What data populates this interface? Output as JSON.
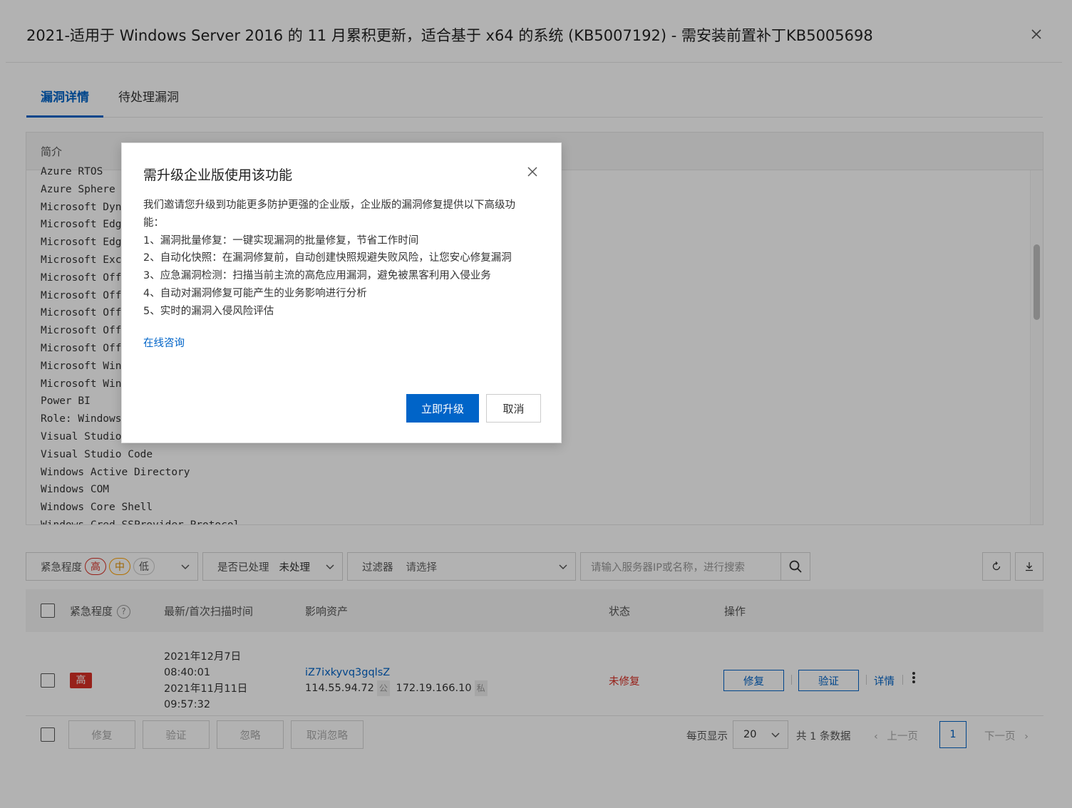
{
  "drawer": {
    "title": "2021-适用于 Windows Server 2016 的 11 月累积更新，适合基于 x64 的系统 (KB5007192) - 需安装前置补丁KB5005698"
  },
  "tabs": [
    {
      "label": "漏洞详情",
      "active": true
    },
    {
      "label": "待处理漏洞",
      "active": false
    }
  ],
  "intro": {
    "header": "简介",
    "items": [
      "Azure RTOS",
      "Azure Sphere",
      "Microsoft Dynamics",
      "Microsoft Edge (Chromium-based)",
      "Microsoft Edge (Chromium-based) in IE Mode",
      "Microsoft Exchange Server",
      "Microsoft Office",
      "Microsoft Office Access",
      "Microsoft Office Excel",
      "Microsoft Office SharePoint",
      "Microsoft Office Word",
      "Microsoft Windows",
      "Microsoft Windows Codecs Library",
      "Power BI",
      "Role: Windows Hyper-V",
      "Visual Studio",
      "Visual Studio Code",
      "Windows Active Directory",
      "Windows COM",
      "Windows Core Shell",
      "Windows Cred SSProvider Protocol"
    ]
  },
  "filters": {
    "severity_label": "紧急程度",
    "severity_high": "高",
    "severity_mid": "中",
    "severity_low": "低",
    "handled_label": "是否已处理",
    "handled_value": "未处理",
    "filter_label": "过滤器",
    "filter_placeholder": "请选择",
    "search_placeholder": "请输入服务器IP或名称，进行搜索"
  },
  "table": {
    "headers": {
      "severity": "紧急程度",
      "help": "?",
      "scan_time": "最新/首次扫描时间",
      "asset": "影响资产",
      "status": "状态",
      "actions": "操作"
    },
    "rows": [
      {
        "severity": "高",
        "latest_date": "2021年12月7日",
        "latest_time": "08:40:01",
        "first_date": "2021年11月11日",
        "first_time": "09:57:32",
        "asset_name": "iZ7ixkyvq3gqlsZ",
        "public_ip": "114.55.94.72",
        "public_tag": "公",
        "private_ip": "172.19.166.10",
        "private_tag": "私",
        "status": "未修复",
        "fix_label": "修复",
        "verify_label": "验证",
        "detail_label": "详情"
      }
    ]
  },
  "bulk": {
    "fix": "修复",
    "verify": "验证",
    "ignore": "忽略",
    "unignore": "取消忽略"
  },
  "pager": {
    "per_page_label": "每页显示",
    "per_page_value": "20",
    "total": "共 1 条数据",
    "prev": "上一页",
    "current": "1",
    "next": "下一页"
  },
  "modal": {
    "title": "需升级企业版使用该功能",
    "intro": "我们邀请您升级到功能更多防护更强的企业版，企业版的漏洞修复提供以下高级功能：",
    "features": [
      "1、漏洞批量修复：一键实现漏洞的批量修复，节省工作时间",
      "2、自动化快照：在漏洞修复前，自动创建快照规避失败风险，让您安心修复漏洞",
      "3、应急漏洞检测：扫描当前主流的高危应用漏洞，避免被黑客利用入侵业务",
      "4、自动对漏洞修复可能产生的业务影响进行分析",
      "5、实时的漏洞入侵风险评估"
    ],
    "consult_link": "在线咨询",
    "upgrade_button": "立即升级",
    "cancel_button": "取消"
  },
  "colors": {
    "primary": "#0064c8",
    "danger": "#d93026",
    "warning": "#ffa200"
  }
}
